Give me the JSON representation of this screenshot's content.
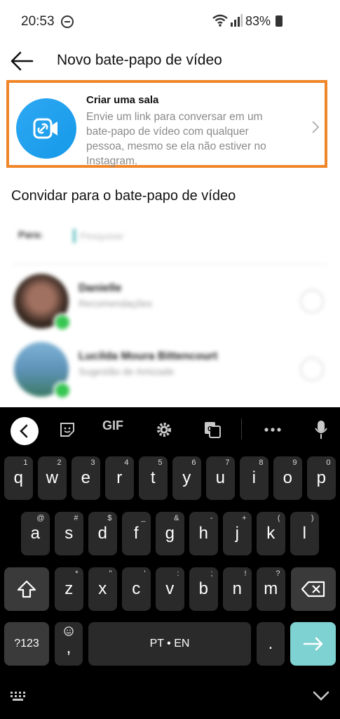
{
  "status": {
    "time": "20:53",
    "battery": "83%"
  },
  "header": {
    "title": "Novo bate-papo de vídeo"
  },
  "room": {
    "title": "Criar uma sala",
    "description": "Envie um link para conversar em um bate-papo de vídeo com qualquer pessoa, mesmo se ela não estiver no Instagram."
  },
  "invite": {
    "section_title": "Convidar para o bate-papo de vídeo",
    "to_label": "Para:",
    "search_placeholder": "Pesquisar",
    "contacts": [
      {
        "name": "Danielle",
        "sub": "Recomendações"
      },
      {
        "name": "Lucilda Moura Bittencourt",
        "sub": "Sugestão de Amizade"
      }
    ]
  },
  "keyboard": {
    "toolbar": {
      "gif": "GIF"
    },
    "row1": [
      {
        "k": "q",
        "s": "1"
      },
      {
        "k": "w",
        "s": "2"
      },
      {
        "k": "e",
        "s": "3"
      },
      {
        "k": "r",
        "s": "4"
      },
      {
        "k": "t",
        "s": "5"
      },
      {
        "k": "y",
        "s": "6"
      },
      {
        "k": "u",
        "s": "7"
      },
      {
        "k": "i",
        "s": "8"
      },
      {
        "k": "o",
        "s": "9"
      },
      {
        "k": "p",
        "s": "0"
      }
    ],
    "row2": [
      {
        "k": "a",
        "s": "@"
      },
      {
        "k": "s",
        "s": "#"
      },
      {
        "k": "d",
        "s": "$"
      },
      {
        "k": "f",
        "s": "_"
      },
      {
        "k": "g",
        "s": "&"
      },
      {
        "k": "h",
        "s": "-"
      },
      {
        "k": "j",
        "s": "+"
      },
      {
        "k": "k",
        "s": "("
      },
      {
        "k": "l",
        "s": ")"
      }
    ],
    "row3": [
      {
        "k": "z",
        "s": "*"
      },
      {
        "k": "x",
        "s": "\""
      },
      {
        "k": "c",
        "s": "'"
      },
      {
        "k": "v",
        "s": ":"
      },
      {
        "k": "b",
        "s": ";"
      },
      {
        "k": "n",
        "s": "!"
      },
      {
        "k": "m",
        "s": "?"
      }
    ],
    "num_label": "?123",
    "comma": ",",
    "space_label": "PT • EN",
    "period": "."
  },
  "colors": {
    "highlight": "#f0862a",
    "accent": "#1599e8",
    "online": "#37c652",
    "enter": "#7ed2d1"
  }
}
